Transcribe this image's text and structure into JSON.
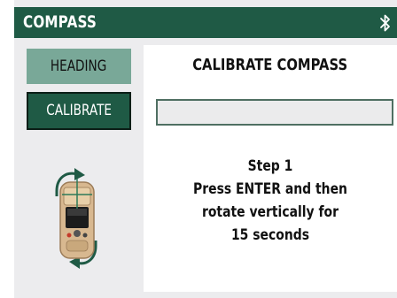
{
  "app": {
    "title": "COMPASS",
    "status_icon": "bluetooth-icon"
  },
  "sidebar": {
    "items": [
      {
        "label": "HEADING",
        "selected": false
      },
      {
        "label": "CALIBRATE",
        "selected": true
      }
    ],
    "device_image": "handheld-device-rotate-vertical-icon"
  },
  "main": {
    "title": "CALIBRATE COMPASS",
    "progress": 0,
    "instructions": {
      "step": "Step 1",
      "line1": "Press ENTER and then",
      "line2": "rotate vertically for",
      "line3": "15 seconds"
    }
  },
  "colors": {
    "brand_dark_green": "#1f5a45",
    "brand_light_green": "#79a898",
    "background": "#ececee"
  }
}
